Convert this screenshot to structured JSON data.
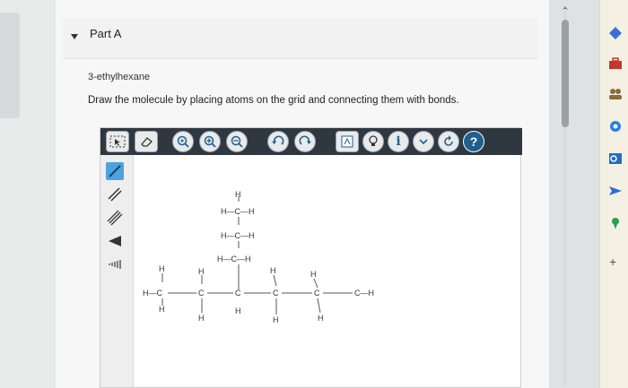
{
  "part": {
    "title": "Part A",
    "expanded": true
  },
  "question": {
    "molecule_name": "3-ethylhexane",
    "instructions": "Draw the molecule by placing atoms on the grid and connecting them with bonds."
  },
  "toolbar": {
    "tools": [
      {
        "icon": "select-icon"
      },
      {
        "icon": "eraser-icon"
      },
      {
        "icon": "zoom-fit-icon"
      },
      {
        "icon": "zoom-in-icon"
      },
      {
        "icon": "zoom-out-icon"
      },
      {
        "icon": "undo-icon"
      },
      {
        "icon": "redo-icon"
      },
      {
        "icon": "templates-icon"
      },
      {
        "icon": "hint-bulb-icon"
      },
      {
        "icon": "info-icon",
        "label": "i"
      },
      {
        "icon": "more-dropdown-icon"
      },
      {
        "icon": "reset-icon"
      },
      {
        "icon": "help-icon",
        "label": "?"
      }
    ]
  },
  "bond_tools": [
    "single-bond-icon",
    "double-bond-icon",
    "triple-bond-icon",
    "wedge-bond-icon",
    "hash-bond-icon"
  ],
  "structure": {
    "atoms": [
      {
        "label": "H"
      },
      {
        "label": "H—C—H"
      },
      {
        "label": "H—C—H"
      },
      {
        "label": "H—C—H"
      },
      {
        "label": "H"
      },
      {
        "label": "H—C"
      },
      {
        "label": "H"
      },
      {
        "label": "H"
      },
      {
        "label": "C"
      },
      {
        "label": "H"
      },
      {
        "label": "C"
      },
      {
        "label": "H"
      },
      {
        "label": "H"
      },
      {
        "label": "C"
      },
      {
        "label": "H"
      },
      {
        "label": "H"
      },
      {
        "label": "C"
      },
      {
        "label": "H"
      },
      {
        "label": "C—H"
      }
    ]
  },
  "colors": {
    "toolbar_bg": "#2f3740",
    "accent_blue": "#2a7fbf",
    "selected_tool": "#4aa3df"
  }
}
